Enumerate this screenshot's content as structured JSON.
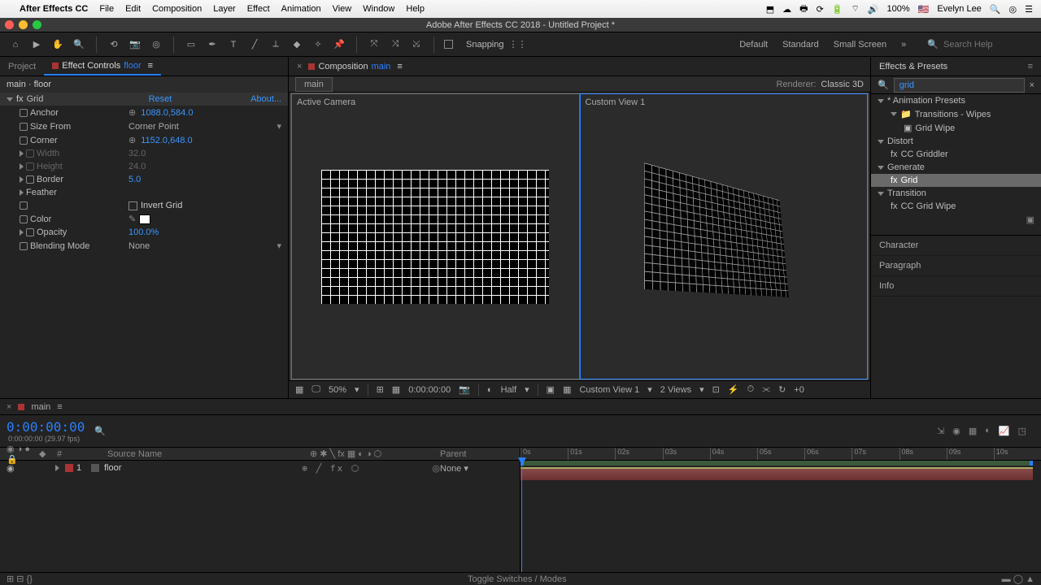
{
  "os_menu": {
    "app": "After Effects CC",
    "items": [
      "File",
      "Edit",
      "Composition",
      "Layer",
      "Effect",
      "Animation",
      "View",
      "Window",
      "Help"
    ],
    "status": {
      "battery": "100%",
      "user": "Evelyn Lee"
    }
  },
  "titlebar": "Adobe After Effects CC 2018 - Untitled Project *",
  "toolbar": {
    "snapping": "Snapping",
    "workspaces": [
      "Default",
      "Standard",
      "Small Screen"
    ],
    "search_placeholder": "Search Help"
  },
  "project_tab": "Project",
  "effect_controls": {
    "panel_label_prefix": "Effect Controls ",
    "panel_label_layer": "floor",
    "header": "main · floor",
    "effect_name": "Grid",
    "reset": "Reset",
    "about": "About...",
    "params": {
      "anchor": {
        "label": "Anchor",
        "value": "1088.0,584.0"
      },
      "size_from": {
        "label": "Size From",
        "value": "Corner Point"
      },
      "corner": {
        "label": "Corner",
        "value": "1152.0,648.0"
      },
      "width": {
        "label": "Width",
        "value": "32.0"
      },
      "height": {
        "label": "Height",
        "value": "24.0"
      },
      "border": {
        "label": "Border",
        "value": "5.0"
      },
      "feather": {
        "label": "Feather"
      },
      "invert": {
        "label": "Invert Grid"
      },
      "color": {
        "label": "Color"
      },
      "opacity": {
        "label": "Opacity",
        "value": "100.0%"
      },
      "blending": {
        "label": "Blending Mode",
        "value": "None"
      }
    }
  },
  "composition": {
    "panel_label_prefix": "Composition ",
    "panel_label_name": "main",
    "subtab": "main",
    "renderer_label": "Renderer:",
    "renderer_value": "Classic 3D",
    "view_left": "Active Camera",
    "view_right": "Custom View 1",
    "bottom": {
      "zoom": "50%",
      "time": "0:00:00:00",
      "res": "Half",
      "view": "Custom View 1",
      "nviews": "2 Views"
    }
  },
  "effects_presets": {
    "title": "Effects & Presets",
    "search": "grid",
    "tree": [
      {
        "label": "* Animation Presets",
        "level": 0
      },
      {
        "label": "Transitions - Wipes",
        "level": 1,
        "icon": "folder"
      },
      {
        "label": "Grid Wipe",
        "level": 2,
        "icon": "preset"
      },
      {
        "label": "Distort",
        "level": 0
      },
      {
        "label": "CC Griddler",
        "level": 1,
        "icon": "fx"
      },
      {
        "label": "Generate",
        "level": 0
      },
      {
        "label": "Grid",
        "level": 1,
        "icon": "fx",
        "selected": true
      },
      {
        "label": "Transition",
        "level": 0
      },
      {
        "label": "CC Grid Wipe",
        "level": 1,
        "icon": "fx"
      }
    ],
    "categories": [
      "Character",
      "Paragraph",
      "Info"
    ]
  },
  "timeline": {
    "tab": "main",
    "timecode": "0:00:00:00",
    "fps": "0:00:00:00 (29.97 fps)",
    "columns": {
      "idx": "#",
      "source": "Source Name",
      "parent": "Parent"
    },
    "layers": [
      {
        "num": "1",
        "name": "floor",
        "parent": "None"
      }
    ],
    "ruler": [
      "0s",
      "01s",
      "02s",
      "03s",
      "04s",
      "05s",
      "06s",
      "07s",
      "08s",
      "09s",
      "10s"
    ],
    "footer": "Toggle Switches / Modes"
  }
}
